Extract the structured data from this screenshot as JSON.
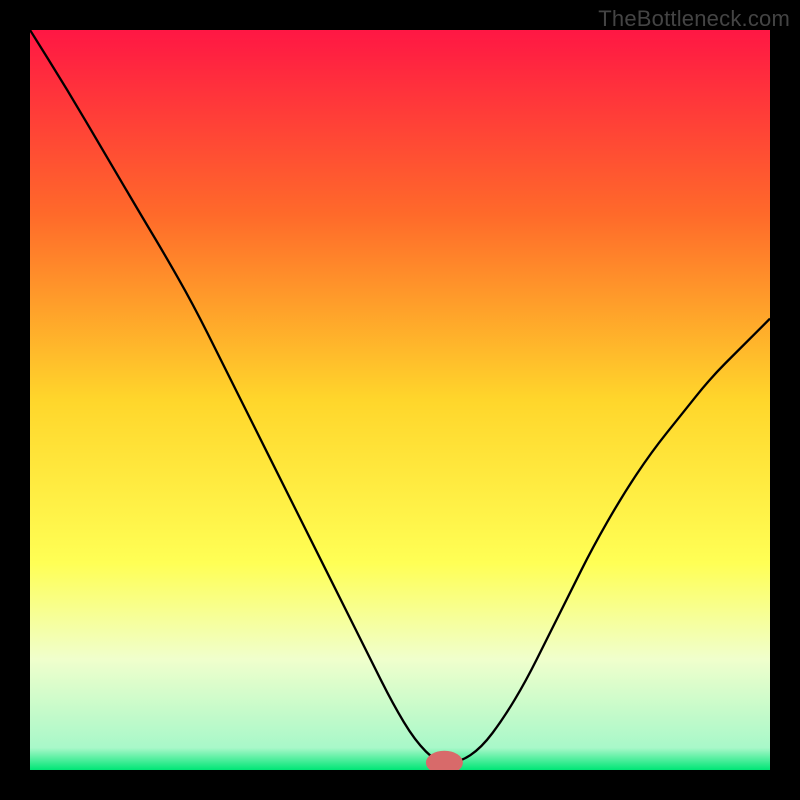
{
  "watermark": "TheBottleneck.com",
  "chart_data": {
    "type": "line",
    "title": "",
    "xlabel": "",
    "ylabel": "",
    "xlim": [
      0,
      100
    ],
    "ylim": [
      0,
      100
    ],
    "grid": false,
    "legend": false,
    "background": {
      "type": "vertical-gradient",
      "stops": [
        {
          "pos": 0,
          "color": "#ff1744"
        },
        {
          "pos": 0.25,
          "color": "#ff6a2a"
        },
        {
          "pos": 0.5,
          "color": "#ffd62b"
        },
        {
          "pos": 0.72,
          "color": "#ffff55"
        },
        {
          "pos": 0.85,
          "color": "#f0ffcc"
        },
        {
          "pos": 0.97,
          "color": "#a8f8c9"
        },
        {
          "pos": 1,
          "color": "#00e676"
        }
      ]
    },
    "marker": {
      "x": 56,
      "y": 1,
      "color": "#d86a6a",
      "rx": 2.5,
      "ry": 1.6
    },
    "series": [
      {
        "name": "curve",
        "color": "#000000",
        "stroke_width": 2.3,
        "x": [
          0,
          5,
          10,
          15,
          18,
          22,
          26,
          30,
          34,
          38,
          42,
          46,
          49,
          52,
          55,
          58,
          61,
          64,
          67,
          70,
          73,
          76,
          80,
          84,
          88,
          92,
          96,
          100
        ],
        "y": [
          100,
          92,
          83.5,
          75,
          70,
          63,
          55,
          47,
          39,
          31,
          23,
          15,
          9,
          4,
          1,
          1,
          3,
          7,
          12,
          18,
          24,
          30,
          37,
          43,
          48,
          53,
          57,
          61
        ]
      }
    ]
  }
}
